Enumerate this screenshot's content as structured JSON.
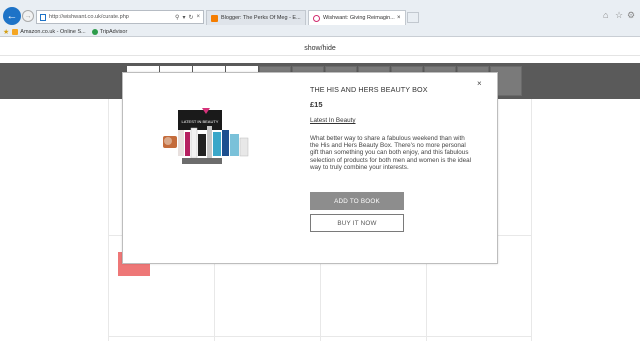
{
  "browser": {
    "url": "http://wishwant.co.uk/curate.php",
    "tabs": [
      {
        "title": "Blogger: The Perks Of Meg - E..."
      },
      {
        "title": "Wishwant: Giving Reimagin..."
      }
    ],
    "favorites": [
      "Amazon.co.uk - Online S...",
      "TripAdvisor"
    ]
  },
  "page": {
    "toggle_label": "show/hide",
    "add_slots": [
      "+",
      "+",
      "+",
      "+"
    ]
  },
  "modal": {
    "title": "THE HIS AND HERS BEAUTY BOX",
    "close": "×",
    "price": "£15",
    "category_link": "Latest In Beauty",
    "description": "What better way to share a fabulous weekend than with the His and Hers Beauty Box. There's no more personal gift than something you can both enjoy, and this fabulous selection of products for both men and women is the ideal way to truly combine your interests.",
    "add_button": "ADD TO BOOK",
    "buy_button": "BUY IT NOW",
    "image_label": "LATEST IN BEAUTY"
  }
}
